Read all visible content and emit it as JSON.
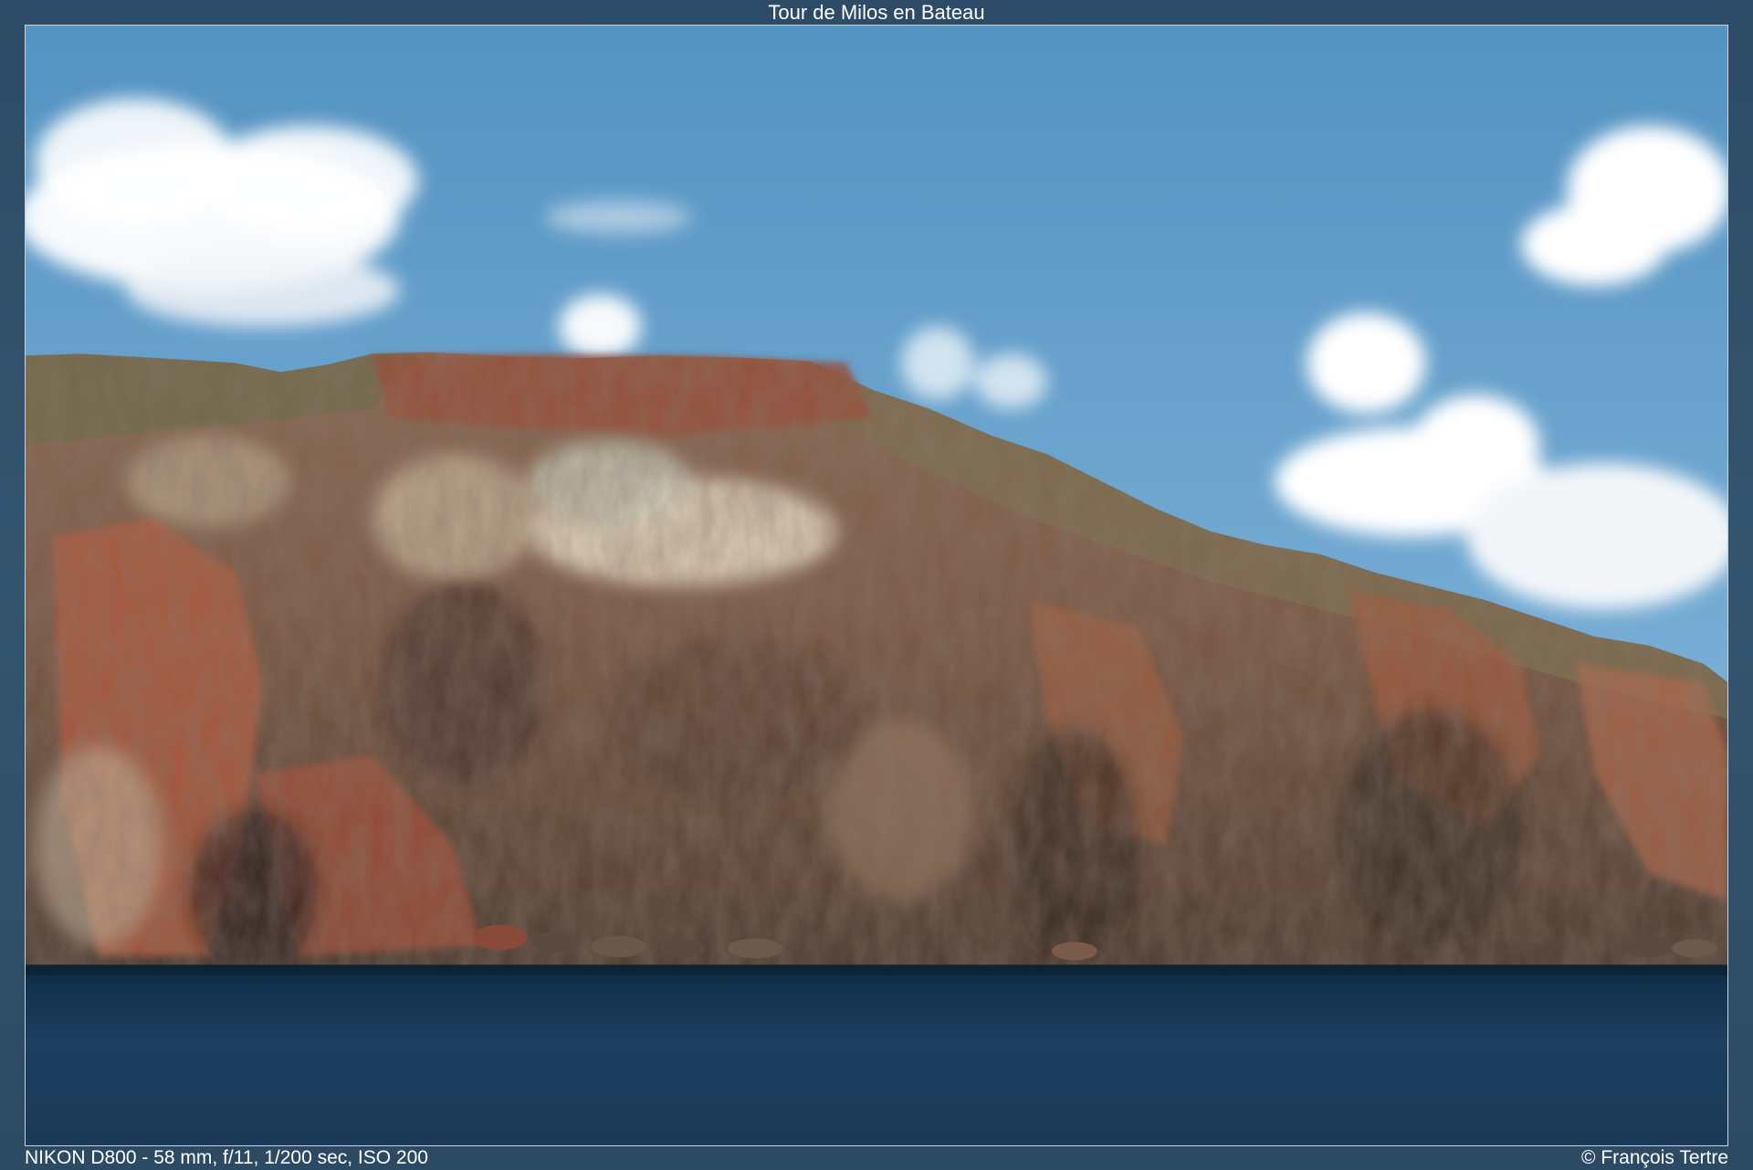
{
  "gallery": {
    "title": "Tour de Milos en Bateau",
    "exif": "NIKON D800 - 58 mm, f/11, 1/200 sec, ISO 200",
    "copyright": "© François Tertre"
  },
  "colors": {
    "frame": "#2f4f6a",
    "sky_top": "#5b97c4",
    "sky_bottom": "#8fbbd8",
    "sea": "#1c3a56",
    "cliff_dark": "#4a3a30",
    "cliff_red": "#a8553a",
    "cliff_light": "#d9c8ad"
  }
}
